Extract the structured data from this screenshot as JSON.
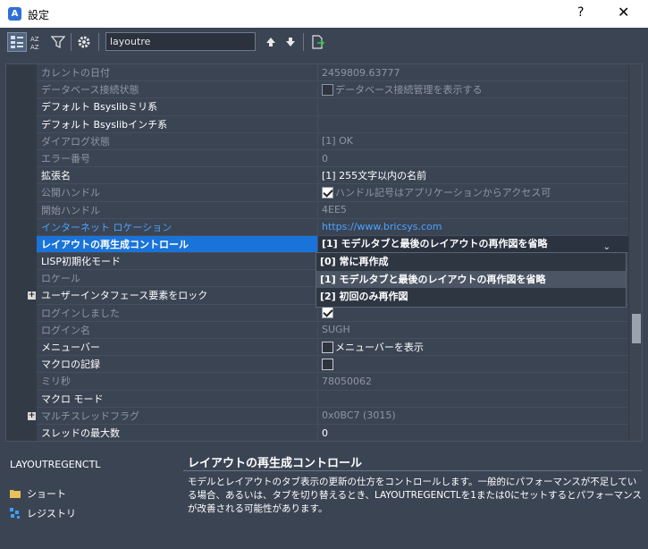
{
  "window": {
    "title": "設定",
    "help": "?",
    "close": "✕"
  },
  "toolbar": {
    "search_value": "layoutre"
  },
  "rows": [
    {
      "name": "カレントの日付",
      "value": "2459809.63777",
      "style": "dim"
    },
    {
      "name": "データベース接続状態",
      "value": "データベース接続管理を表示する",
      "style": "dim",
      "check": "off"
    },
    {
      "name": "デフォルト Bsyslibミリ系",
      "value": "",
      "style": ""
    },
    {
      "name": "デフォルト Bsyslibインチ系",
      "value": "",
      "style": ""
    },
    {
      "name": "ダイアログ状態",
      "value": "[1] OK",
      "style": "dim"
    },
    {
      "name": "エラー番号",
      "value": "0",
      "style": "dim"
    },
    {
      "name": "拡張名",
      "value": "[1] 255文字以内の名前",
      "style": ""
    },
    {
      "name": "公開ハンドル",
      "value": "ハンドル記号はアプリケーションからアクセス可",
      "style": "dim",
      "check": "on"
    },
    {
      "name": "開始ハンドル",
      "value": "4EE5",
      "style": "dim"
    },
    {
      "name": "インターネット ロケーション",
      "value": "https://www.bricsys.com",
      "style": "link"
    },
    {
      "name": "レイアウトの再生成コントロール",
      "value": "[1] モデルタブと最後のレイアウトの再作図を省略",
      "style": "selected",
      "dropdown": true
    },
    {
      "name": "LISP初期化モード",
      "value": "",
      "style": ""
    },
    {
      "name": "ロケール",
      "value": "",
      "style": "dim"
    },
    {
      "name": "ユーザーインタフェース要素をロック",
      "value": "",
      "style": "",
      "expander": true
    },
    {
      "name": "ログインしました",
      "value": "",
      "style": "dim",
      "check": "on"
    },
    {
      "name": "ログイン名",
      "value": "SUGH",
      "style": "dim"
    },
    {
      "name": "メニューバー",
      "value": "メニューバーを表示",
      "style": "",
      "check": "off"
    },
    {
      "name": "マクロの記録",
      "value": "",
      "style": "",
      "check": "off"
    },
    {
      "name": "ミリ秒",
      "value": "78050062",
      "style": "dim"
    },
    {
      "name": "マクロ モード",
      "value": "",
      "style": ""
    },
    {
      "name": "マルチスレッドフラグ",
      "value": "0x0BC7 (3015)",
      "style": "dim",
      "expander": true
    },
    {
      "name": "スレッドの最大数",
      "value": "0",
      "style": ""
    }
  ],
  "dropdown": {
    "options": [
      "[0] 常に再作成",
      "[1] モデルタブと最後のレイアウトの再作図を省略",
      "[2] 初回のみ再作図"
    ],
    "highlighted_index": 1
  },
  "bottom": {
    "command_name": "LAYOUTREGENCTL",
    "links": [
      "ショート",
      "レジストリ"
    ],
    "desc_title": "レイアウトの再生成コントロール",
    "desc_body": "モデルとレイアウトのタブ表示の更新の仕方をコントロールします。一般的にパフォーマンスが不足している場合、あるいは、タブを切り替えるとき、LAYOUTREGENCTLを1または0にセットするとパフォーマンスが改善される可能性があります。"
  }
}
